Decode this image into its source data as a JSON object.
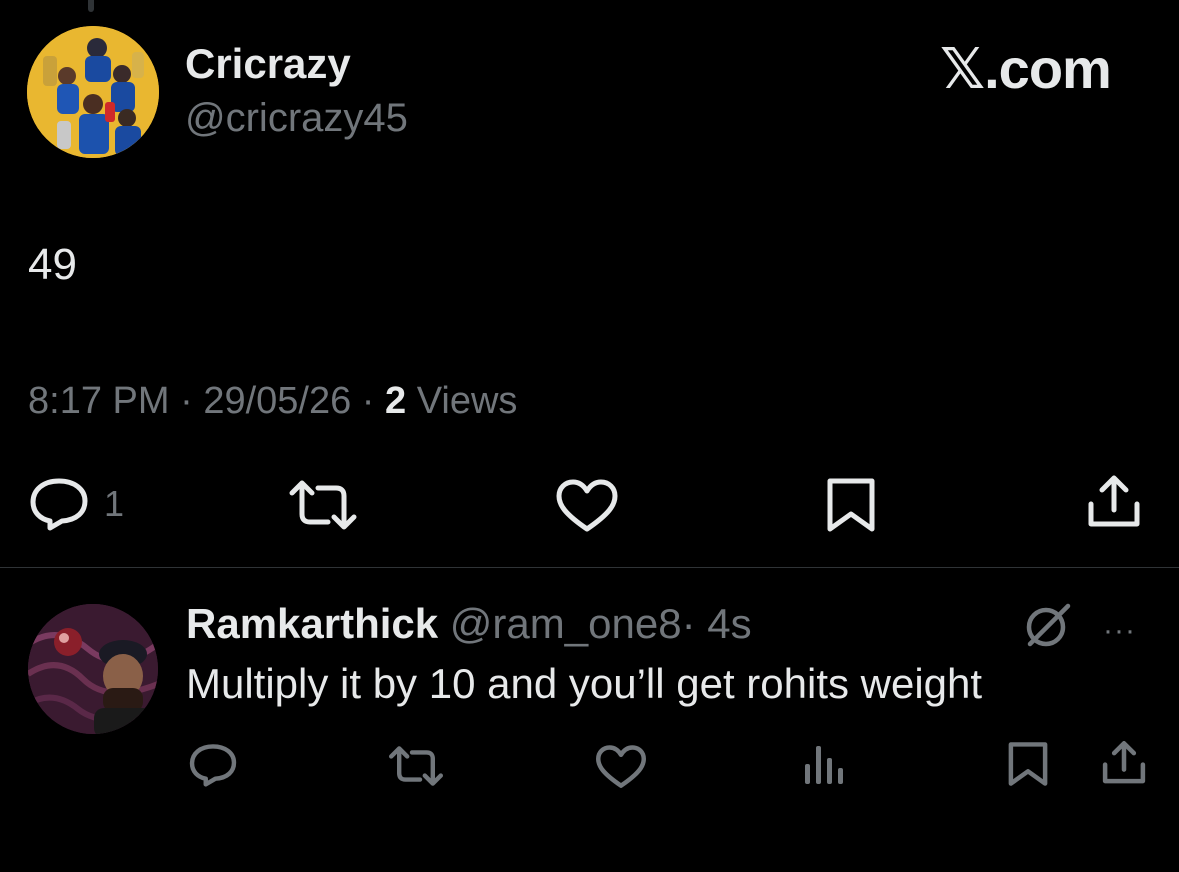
{
  "tweet": {
    "author_name": "Cricrazy",
    "author_handle": "@cricrazy45",
    "text": "49",
    "time": "8:17 PM",
    "separator": "·",
    "date": "29/05/26",
    "views_count": "2",
    "views_label": "Views",
    "reply_count": "1"
  },
  "brand": {
    "x": "𝕏",
    "suffix": ".com"
  },
  "reply": {
    "author_name": "Ramkarthick",
    "author_handle": "@ram_one8",
    "separator": "·",
    "age": "4s",
    "text": "Multiply it by 10 and you’ll get rohits weight",
    "more": "···"
  },
  "icons": [
    "reply-icon",
    "retweet-icon",
    "like-icon",
    "bookmark-icon",
    "share-icon",
    "views-chart-icon",
    "grok-icon",
    "more-icon"
  ],
  "colors": {
    "background": "#000000",
    "text": "#e7e9ea",
    "secondary": "#71767b",
    "divider": "#2f3336"
  }
}
